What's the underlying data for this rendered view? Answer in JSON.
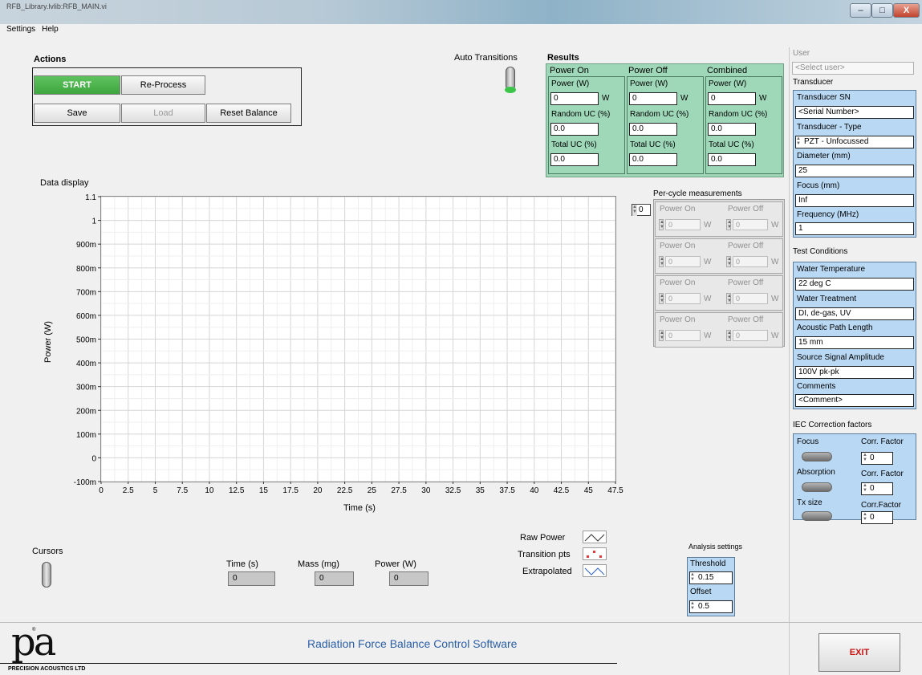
{
  "window": {
    "title": "RFB_Library.lvlib:RFB_MAIN.vi",
    "min": "–",
    "max": "□",
    "close": "X"
  },
  "menu": [
    "Settings",
    "Help"
  ],
  "actions": {
    "title": "Actions",
    "start": "START",
    "reprocess": "Re-Process",
    "save": "Save",
    "load": "Load",
    "reset_balance": "Reset Balance"
  },
  "auto_transitions": {
    "label": "Auto Transitions",
    "led_color": "#3bc64a"
  },
  "results": {
    "title": "Results",
    "columns": [
      {
        "head": "Power On",
        "power_label": "Power (W)",
        "power": "0",
        "unit": "W",
        "random_label": "Random UC (%)",
        "random": "0.0",
        "total_label": "Total UC (%)",
        "total": "0.0"
      },
      {
        "head": "Power Off",
        "power_label": "Power (W)",
        "power": "0",
        "unit": "W",
        "random_label": "Random UC (%)",
        "random": "0.0",
        "total_label": "Total UC (%)",
        "total": "0.0"
      },
      {
        "head": "Combined",
        "power_label": "Power (W)",
        "power": "0",
        "unit": "W",
        "random_label": "Random UC (%)",
        "random": "0.0",
        "total_label": "Total UC (%)",
        "total": "0.0"
      }
    ],
    "color": "#9fd8b9"
  },
  "per_cycle": {
    "label": "Per-cycle measurements",
    "index": "0",
    "rows": [
      {
        "on": "Power On",
        "off": "Power Off",
        "on_val": "0",
        "off_val": "0",
        "unit": "W"
      },
      {
        "on": "Power On",
        "off": "Power Off",
        "on_val": "0",
        "off_val": "0",
        "unit": "W"
      },
      {
        "on": "Power On",
        "off": "Power Off",
        "on_val": "0",
        "off_val": "0",
        "unit": "W"
      },
      {
        "on": "Power On",
        "off": "Power Off",
        "on_val": "0",
        "off_val": "0",
        "unit": "W"
      }
    ]
  },
  "user": {
    "label": "User",
    "placeholder": "<Select user>"
  },
  "transducer": {
    "title": "Transducer",
    "sn_label": "Transducer SN",
    "sn": "<Serial Number>",
    "type_label": "Transducer - Type",
    "type": "PZT - Unfocussed",
    "diameter_label": "Diameter (mm)",
    "diameter": "25",
    "focus_label": "Focus (mm)",
    "focus": "Inf",
    "freq_label": "Frequency (MHz)",
    "freq": "1"
  },
  "test_conditions": {
    "title": "Test Conditions",
    "water_temp_label": "Water Temperature",
    "water_temp": "22 deg C",
    "water_treat_label": "Water Treatment",
    "water_treat": "DI, de-gas, UV",
    "path_label": "Acoustic Path Length",
    "path": "15 mm",
    "amp_label": "Source Signal Amplitude",
    "amp": "100V pk-pk",
    "comments_label": "Comments",
    "comments": "<Comment>"
  },
  "iec": {
    "title": "IEC Correction factors",
    "rows": [
      {
        "label": "Focus",
        "cf_label": "Corr. Factor",
        "cf": "0"
      },
      {
        "label": "Absorption",
        "cf_label": "Corr. Factor",
        "cf": "0"
      },
      {
        "label": "Tx size",
        "cf_label": "Corr.Factor",
        "cf": "0"
      }
    ]
  },
  "data_display": {
    "label": "Data display"
  },
  "chart_data": {
    "type": "line",
    "title": "",
    "xlabel": "Time (s)",
    "ylabel": "Power (W)",
    "xlim": [
      0,
      47.5
    ],
    "ylim": [
      -0.1,
      1.1
    ],
    "x_ticks": [
      "0",
      "2.5",
      "5",
      "7.5",
      "10",
      "12.5",
      "15",
      "17.5",
      "20",
      "22.5",
      "25",
      "27.5",
      "30",
      "32.5",
      "35",
      "37.5",
      "40",
      "42.5",
      "45",
      "47.5"
    ],
    "y_ticks": [
      "1.1",
      "1",
      "900m",
      "800m",
      "700m",
      "600m",
      "500m",
      "400m",
      "300m",
      "200m",
      "100m",
      "0",
      "-100m"
    ],
    "grid": true,
    "series": [
      {
        "name": "Raw Power",
        "values": []
      },
      {
        "name": "Transition pts",
        "values": []
      },
      {
        "name": "Extrapolated",
        "values": []
      }
    ]
  },
  "legend": {
    "raw": "Raw Power",
    "transition": "Transition pts",
    "extrapolated": "Extrapolated"
  },
  "cursors": {
    "label": "Cursors",
    "time_label": "Time (s)",
    "time": "0",
    "mass_label": "Mass (mg)",
    "mass": "0",
    "power_label": "Power (W)",
    "power": "0"
  },
  "analysis": {
    "title": "Analysis settings",
    "threshold_label": "Threshold",
    "threshold": "0.15",
    "offset_label": "Offset",
    "offset": "0.5"
  },
  "footer": {
    "logo": "pa",
    "company": "PRECISION ACOUSTICS LTD",
    "app_title": "Radiation Force Balance Control Software",
    "exit": "EXIT"
  }
}
